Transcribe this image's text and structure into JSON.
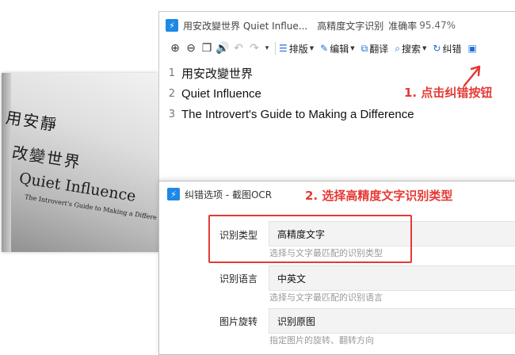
{
  "photo": {
    "line1": "用安靜",
    "line2": "改變世界",
    "line3": "Quiet Influence",
    "line4": "The Introvert's Guide to Making a Differe"
  },
  "window": {
    "title": "用安改變世界 Quiet Influe...",
    "quality": "高精度文字识别",
    "rate_label": "准确率",
    "rate_value": "95.47%"
  },
  "toolbar": {
    "layout_label": "排版",
    "edit_label": "编辑",
    "translate_label": "翻译",
    "search_label": "搜索",
    "correct_label": "纠错"
  },
  "lines": [
    {
      "num": "1",
      "text": "用安改變世界"
    },
    {
      "num": "2",
      "text": "Quiet Influence"
    },
    {
      "num": "3",
      "text": "The Introvert's Guide to Making a Difference"
    }
  ],
  "annotations": {
    "step1": "1. 点击纠错按钮",
    "step2": "2. 选择高精度文字识别类型",
    "color": "#e53935"
  },
  "dialog": {
    "title": "纠错选项 - 截图OCR",
    "rows": [
      {
        "label": "识别类型",
        "value": "高精度文字",
        "hint": "选择与文字最匹配的识别类型"
      },
      {
        "label": "识别语言",
        "value": "中英文",
        "hint": "选择与文字最匹配的识别语言"
      },
      {
        "label": "图片旋转",
        "value": "识别原图",
        "hint": "指定图片的旋转、翻转方向"
      }
    ]
  },
  "colors": {
    "accent": "#1e88e5"
  }
}
